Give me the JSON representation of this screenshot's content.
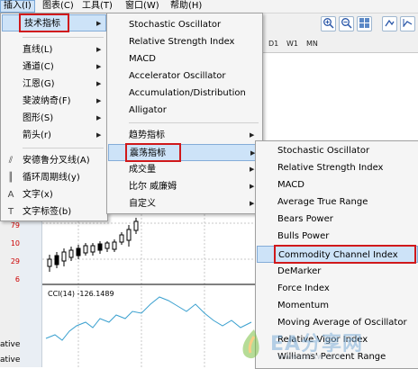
{
  "menubar": {
    "items": [
      {
        "label": "插入(I)",
        "active": true
      },
      {
        "label": "图表(C)",
        "active": false
      },
      {
        "label": "工具(T)",
        "active": false
      },
      {
        "label": "窗口(W)",
        "active": false
      },
      {
        "label": "帮助(H)",
        "active": false
      }
    ]
  },
  "toolbar": {
    "timeframes": [
      "D1",
      "W1",
      "MN"
    ]
  },
  "insert_menu": {
    "items": [
      {
        "label": "技术指标",
        "has_submenu": true,
        "highlighted": true
      },
      {
        "label": "直线(L)",
        "has_submenu": true
      },
      {
        "label": "通道(C)",
        "has_submenu": true
      },
      {
        "label": "江恩(G)",
        "has_submenu": true
      },
      {
        "label": "斐波纳奇(F)",
        "has_submenu": true
      },
      {
        "label": "图形(S)",
        "has_submenu": true
      },
      {
        "label": "箭头(r)",
        "has_submenu": true
      },
      {
        "label": "安德鲁分叉线(A)",
        "has_submenu": false
      },
      {
        "label": "循环周期线(y)",
        "has_submenu": false
      },
      {
        "label": "文字(x)",
        "has_submenu": false
      },
      {
        "label": "文字标签(b)",
        "has_submenu": false
      }
    ]
  },
  "indicators_menu": {
    "items": [
      {
        "label": "Stochastic Oscillator"
      },
      {
        "label": "Relative Strength Index"
      },
      {
        "label": "MACD"
      },
      {
        "label": "Accelerator Oscillator"
      },
      {
        "label": "Accumulation/Distribution"
      },
      {
        "label": "Alligator"
      },
      {
        "label": "趋势指标",
        "has_submenu": true
      },
      {
        "label": "震荡指标",
        "has_submenu": true,
        "highlighted": true
      },
      {
        "label": "成交量",
        "has_submenu": true
      },
      {
        "label": "比尔 威廉姆",
        "has_submenu": true
      },
      {
        "label": "自定义",
        "has_submenu": true
      }
    ]
  },
  "oscillators_menu": {
    "items": [
      {
        "label": "Stochastic Oscillator"
      },
      {
        "label": "Relative Strength Index"
      },
      {
        "label": "MACD"
      },
      {
        "label": "Average True Range"
      },
      {
        "label": "Bears Power"
      },
      {
        "label": "Bulls Power"
      },
      {
        "label": "Commodity Channel Index",
        "highlighted": true
      },
      {
        "label": "DeMarker"
      },
      {
        "label": "Force Index"
      },
      {
        "label": "Momentum"
      },
      {
        "label": "Moving Average of Oscillator"
      },
      {
        "label": "Relative Vigor Index"
      },
      {
        "label": "Williams' Percent Range"
      }
    ]
  },
  "chart": {
    "cci_label": "CCI(14) -126.1489"
  },
  "left_panel": {
    "numbers": [
      "79",
      "10",
      "29",
      "6"
    ],
    "bottom_labels": [
      "ative",
      "ative"
    ]
  },
  "watermark": {
    "text": "EA分享网",
    "url": "www.eafxw.com"
  },
  "colors": {
    "highlight": "#cde3f8",
    "red_box": "#d0181b",
    "cci_line": "#3aa0cf"
  }
}
